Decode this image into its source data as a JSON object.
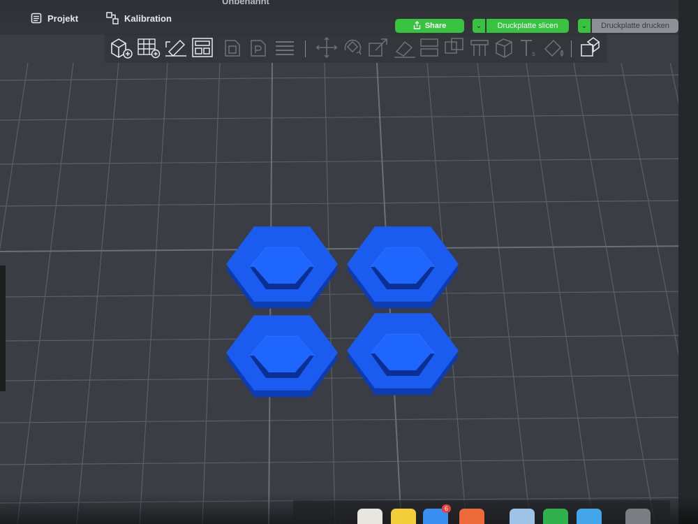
{
  "window": {
    "title": "Unbenannt"
  },
  "tabs": [
    {
      "label": "Projekt",
      "icon": "document-icon"
    },
    {
      "label": "Kalibration",
      "icon": "calibration-icon"
    }
  ],
  "actions": {
    "share_label": "Share",
    "slice_label": "Druckplatte slicen",
    "print_label": "Druckplatte drucken"
  },
  "toolbar": {
    "tools": [
      "add-object-icon",
      "grid-plate-icon",
      "auto-orient-icon",
      "arrange-icon",
      "plate-icon",
      "plate-p-icon",
      "layers-icon",
      "move-icon",
      "rotate-icon",
      "scale-icon",
      "lay-flat-icon",
      "cut-icon",
      "boolean-icon",
      "support-paint-icon",
      "seam-icon",
      "text-icon",
      "color-paint-icon",
      "assembly-icon"
    ]
  },
  "colors": {
    "model": "#1a5cf0",
    "accent": "#37c340",
    "plate": "#3a3d43",
    "grid": "#5a5e66"
  },
  "dock": {
    "badge_count": "6"
  }
}
